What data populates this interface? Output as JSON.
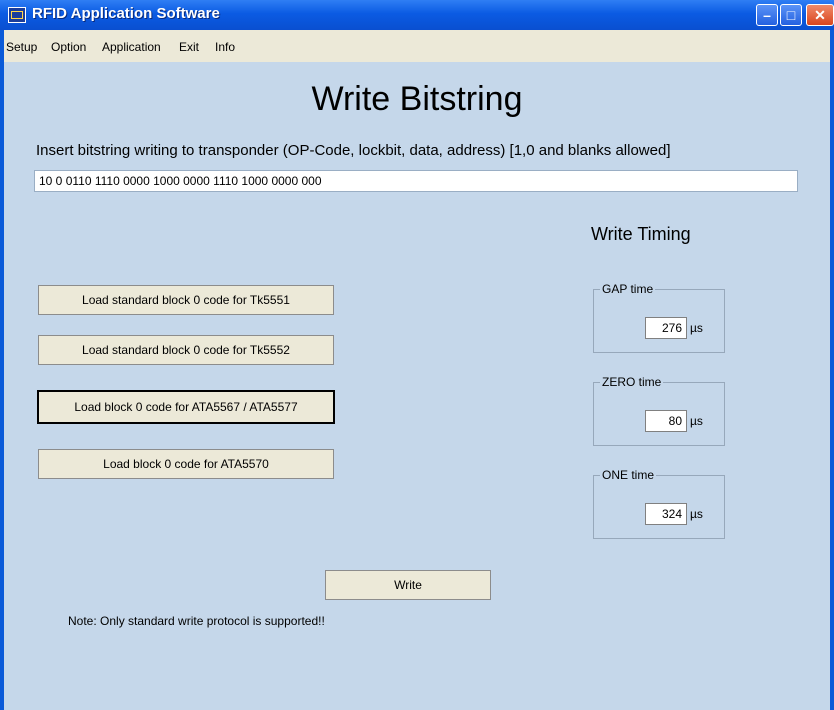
{
  "window": {
    "title": "RFID Application Software",
    "minimize": "–",
    "maximize": "□",
    "close": "✕"
  },
  "menu": [
    "Setup",
    "Option",
    "Application",
    "Exit",
    "Info"
  ],
  "heading": "Write Bitstring",
  "instruction": "Insert bitstring writing to transponder (OP-Code, lockbit, data, address) [1,0 and blanks allowed]",
  "bitstring": "10 0 0110 1110 0000 1000 0000 1110 1000 0000 000",
  "timing": {
    "title": "Write Timing",
    "gap": {
      "label": "GAP time",
      "value": "276",
      "unit": "µs"
    },
    "zero": {
      "label": "ZERO time",
      "value": "80",
      "unit": "µs"
    },
    "one": {
      "label": "ONE time",
      "value": "324",
      "unit": "µs"
    }
  },
  "buttons": {
    "tk5551": "Load standard block 0 code for Tk5551",
    "tk5552": "Load standard block 0 code for Tk5552",
    "ata5567": "Load block 0 code for ATA5567 / ATA5577",
    "ata5570": "Load block 0 code for ATA5570",
    "write": "Write"
  },
  "note": "Note: Only standard write protocol is supported!!"
}
